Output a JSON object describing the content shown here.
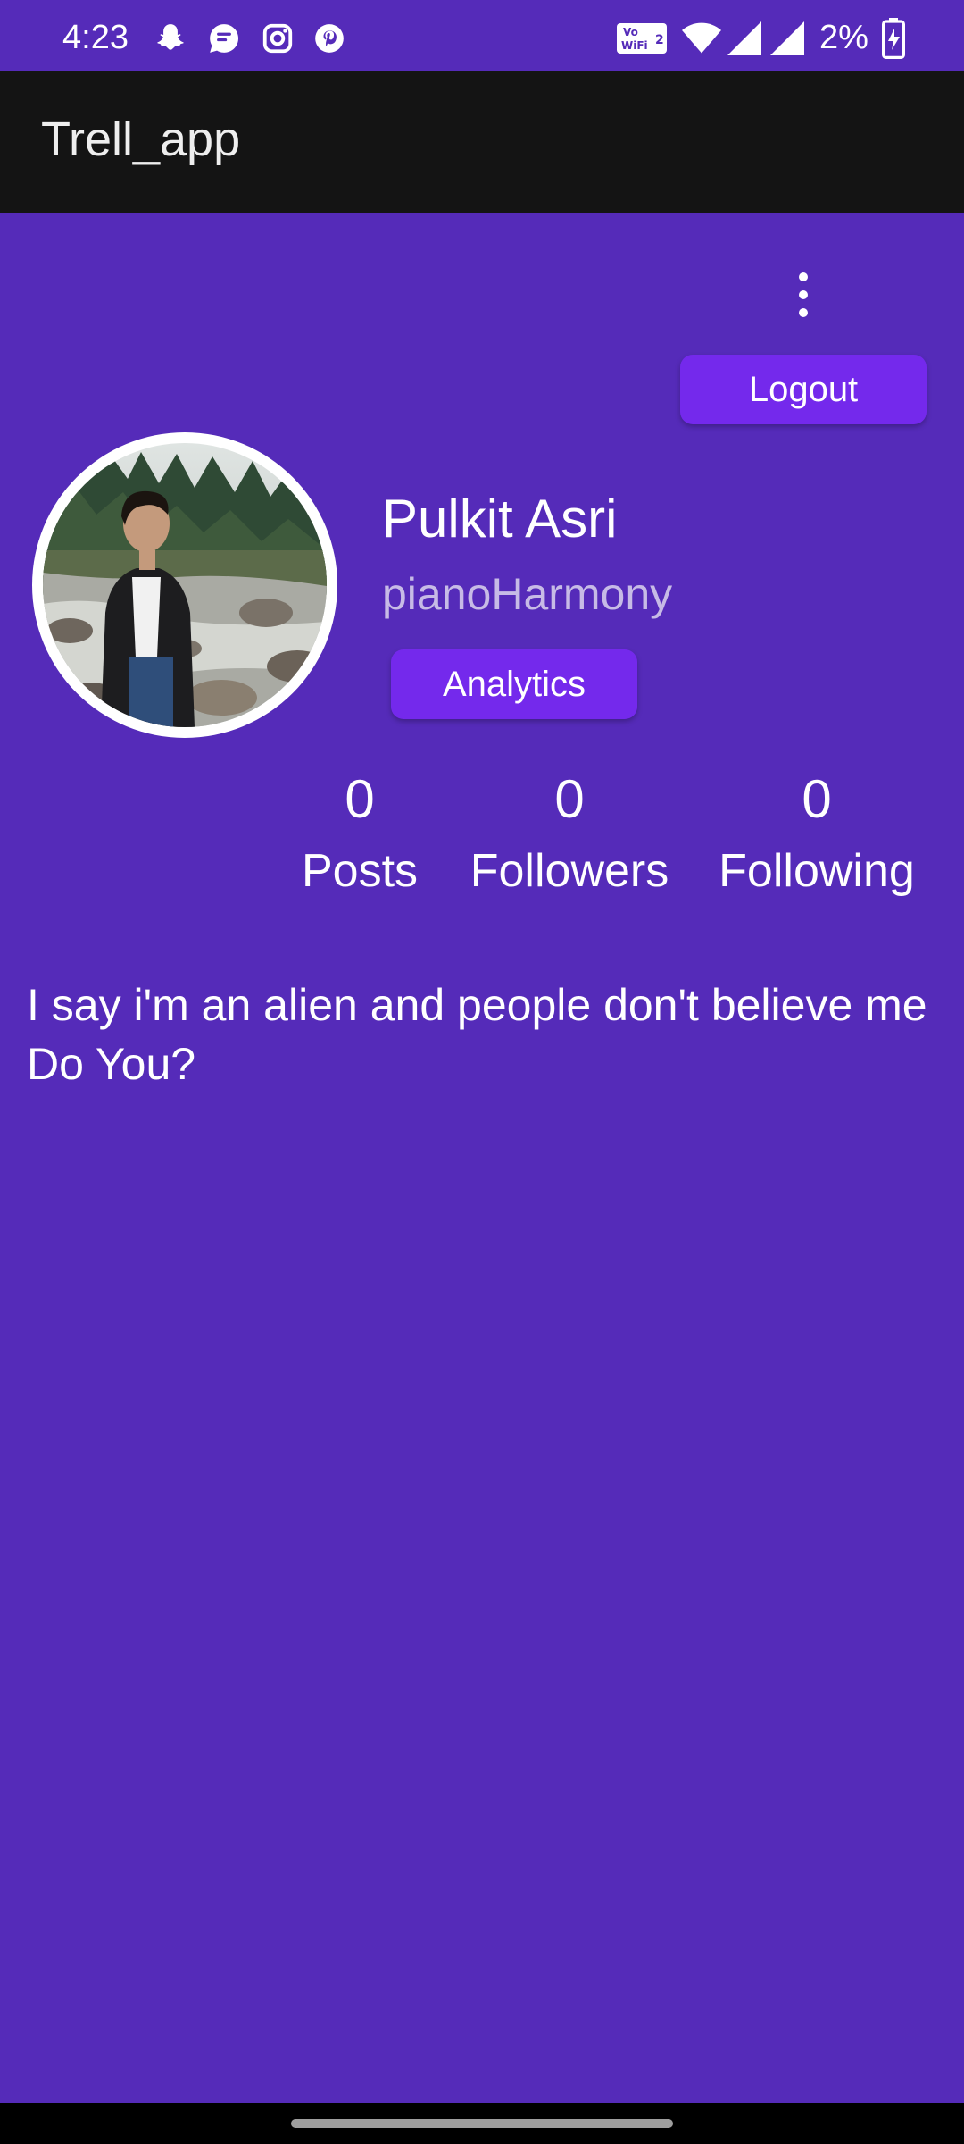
{
  "status_bar": {
    "time": "4:23",
    "notification_icons": [
      "snapchat-icon",
      "messaging-icon",
      "instagram-icon",
      "pinterest-icon"
    ],
    "system_icons": [
      "vowifi-icon",
      "wifi-icon",
      "signal-icon",
      "signal-icon"
    ],
    "vowifi_text": "Vo WiFi 2",
    "battery_percent": "2%",
    "battery_icon": "battery-charging-icon"
  },
  "app_bar": {
    "title": "Trell_app"
  },
  "toolbar": {
    "menu_icon": "more-vert-icon",
    "logout_label": "Logout"
  },
  "profile": {
    "name": "Pulkit Asri",
    "username": "pianoHarmony",
    "analytics_label": "Analytics",
    "avatar_icon": "profile-photo"
  },
  "stats": [
    {
      "count": "0",
      "label": "Posts"
    },
    {
      "count": "0",
      "label": "Followers"
    },
    {
      "count": "0",
      "label": "Following"
    }
  ],
  "bio": "I say i'm an alien and people don't believe me\nDo You?",
  "colors": {
    "background": "#552bb9",
    "app_bar": "#141414",
    "button": "#7429ec",
    "username_text": "#c7bbe6"
  }
}
